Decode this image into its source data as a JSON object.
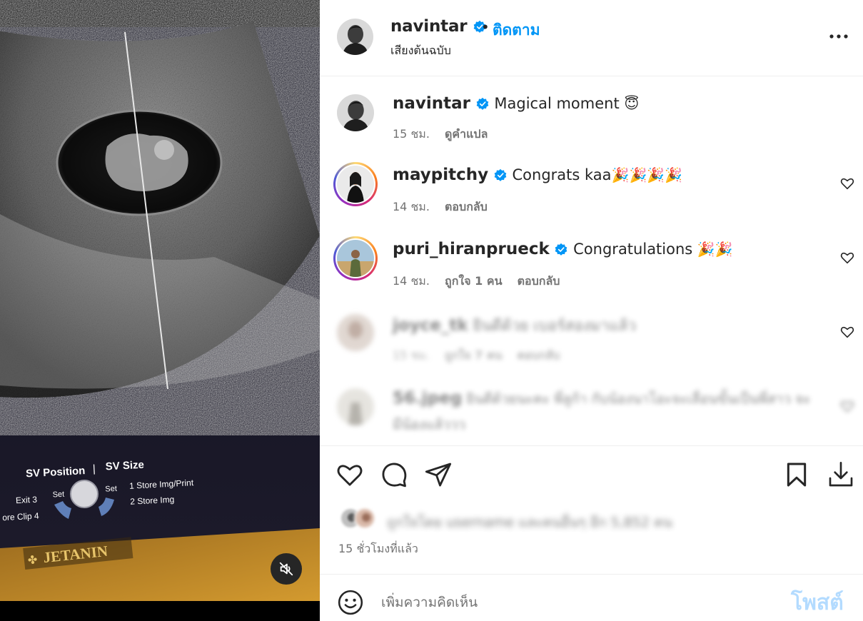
{
  "media": {
    "overlay": {
      "sv_position": "SV Position",
      "separator": "|",
      "sv_size": "SV Size",
      "exit": "Exit 3",
      "store_clip": "ore Clip 4",
      "set_left": "Set",
      "set_right": "Set",
      "store_print": "1 Store Img/Print",
      "store_img": "2 Store Img",
      "brand": "JETANIN"
    },
    "mute_icon": "speaker-muted-icon"
  },
  "header": {
    "username": "navintar",
    "dot": "•",
    "follow_label": "ติดตาม",
    "audio": "เสียงต้นฉบับ",
    "more_icon": "more-horizontal-icon"
  },
  "caption": {
    "username": "navintar",
    "text": "Magical moment",
    "emoji": "😇",
    "time": "15 ชม.",
    "translate": "ดูคำแปล"
  },
  "comments": [
    {
      "username": "maypitchy",
      "text": "Congrats kaa",
      "emoji": "🎉🎉🎉🎉",
      "time": "14 ชม.",
      "likes": "",
      "reply": "ตอบกลับ"
    },
    {
      "username": "puri_hiranprueck",
      "text": "Congratulations",
      "emoji": "🎉🎉",
      "time": "14 ชม.",
      "likes": "ถูกใจ 1 คน",
      "reply": "ตอบกลับ"
    },
    {
      "username": "joyce_tk",
      "text": "ยินดีด้วย เบอร์สองมาแล้ว",
      "emoji": "",
      "time": "15 ชม.",
      "likes": "ถูกใจ 7 คน",
      "reply": "ตอบกลับ"
    },
    {
      "username": "56.jpeg",
      "text": "ยินดีด้วยนะคะ พี่ลูก้า กับน้องนาโอะจะเลื่อนขั้นเป็นพี่สาว จะ",
      "text2": "มีน้องแล้ววว",
      "emoji": "",
      "time": "",
      "likes": "",
      "reply": ""
    }
  ],
  "actions": {
    "like_icon": "heart-icon",
    "comment_icon": "comment-icon",
    "share_icon": "paper-plane-icon",
    "save_icon": "bookmark-icon",
    "download_icon": "download-icon",
    "likes_text": "ถูกใจโดย username และคนอื่นๆ อีก 5,852 คน",
    "time_ago": "15 ชั่วโมงที่แล้ว"
  },
  "add_comment": {
    "emoji_icon": "smiley-icon",
    "placeholder": "เพิ่มความคิดเห็น",
    "post_label": "โพสต์"
  },
  "colors": {
    "link_blue": "#0095f6",
    "post_disabled": "#b3dbff",
    "meta_gray": "#737373",
    "verified_blue": "#0095f6"
  }
}
